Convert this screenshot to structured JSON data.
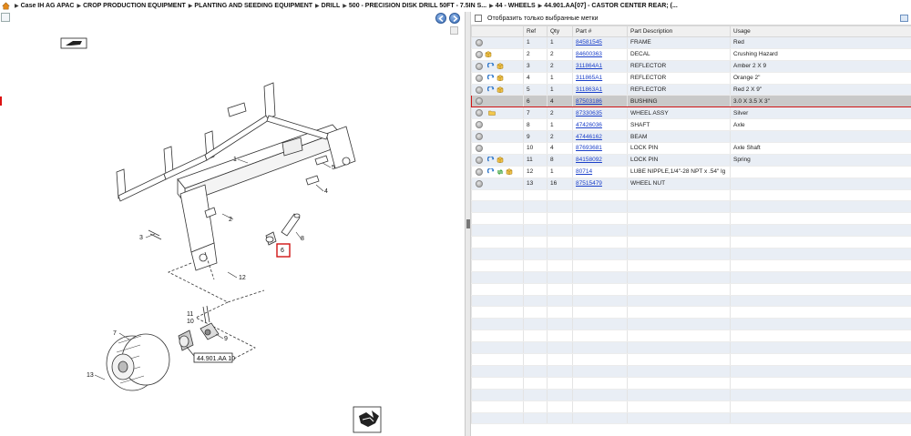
{
  "breadcrumb": [
    "Case IH AG APAC",
    "CROP PRODUCTION EQUIPMENT",
    "PLANTING AND SEEDING EQUIPMENT",
    "DRILL",
    "500 - PRECISION DISK DRILL 50FT - 7.5IN S...",
    "44 - WHEELS",
    "44.901.AA[07] - CASTOR CENTER REAR; (..."
  ],
  "filter": {
    "label": "Отобразить только выбранные метки"
  },
  "table": {
    "headers": [
      "",
      "Ref",
      "Qty",
      "Part #",
      "Part Description",
      "Usage"
    ],
    "rows": [
      {
        "ref": "1",
        "qty": "1",
        "part": "84581545",
        "desc": "FRAME",
        "usage": "Red",
        "icons": []
      },
      {
        "ref": "2",
        "qty": "2",
        "part": "84600363",
        "desc": "DECAL",
        "usage": "Crushing Hazard",
        "icons": [
          "box"
        ]
      },
      {
        "ref": "3",
        "qty": "2",
        "part": "311864A1",
        "desc": "REFLECTOR",
        "usage": "Amber 2 X 9",
        "icons": [
          "refresh",
          "box"
        ]
      },
      {
        "ref": "4",
        "qty": "1",
        "part": "311865A1",
        "desc": "REFLECTOR",
        "usage": "Orange 2\"",
        "icons": [
          "refresh",
          "box"
        ]
      },
      {
        "ref": "5",
        "qty": "1",
        "part": "311863A1",
        "desc": "REFLECTOR",
        "usage": "Red 2 X 9\"",
        "icons": [
          "refresh",
          "box"
        ]
      },
      {
        "ref": "6",
        "qty": "4",
        "part": "87503186",
        "desc": "BUSHING",
        "usage": "3.0 X 3.5 X 3\"",
        "icons": [],
        "selected": true
      },
      {
        "ref": "7",
        "qty": "2",
        "part": "87330635",
        "desc": "WHEEL ASSY",
        "usage": "Silver",
        "icons": [
          "folder"
        ]
      },
      {
        "ref": "8",
        "qty": "1",
        "part": "47426036",
        "desc": "SHAFT",
        "usage": "Axle",
        "icons": []
      },
      {
        "ref": "9",
        "qty": "2",
        "part": "47446162",
        "desc": "BEAM",
        "usage": "",
        "icons": []
      },
      {
        "ref": "10",
        "qty": "4",
        "part": "87693681",
        "desc": "LOCK PIN",
        "usage": "Axle Shaft",
        "icons": []
      },
      {
        "ref": "11",
        "qty": "8",
        "part": "84158092",
        "desc": "LOCK PIN",
        "usage": "Spring",
        "icons": [
          "refresh",
          "box"
        ]
      },
      {
        "ref": "12",
        "qty": "1",
        "part": "80714",
        "desc": "LUBE NIPPLE,1/4\"-28 NPT x .54\" lg",
        "usage": "",
        "icons": [
          "refresh",
          "arrows",
          "box"
        ]
      },
      {
        "ref": "13",
        "qty": "16",
        "part": "87515479",
        "desc": "WHEEL NUT",
        "usage": "",
        "icons": []
      }
    ]
  },
  "diagram": {
    "callouts": [
      "1",
      "2",
      "3",
      "4",
      "5",
      "6",
      "7",
      "8",
      "9",
      "10",
      "11",
      "12",
      "13"
    ],
    "reference_label": "44.901.AA 10"
  },
  "colors": {
    "link": "#1a3fc9",
    "selection_border": "#d01414",
    "alt_row": "#e9eef5"
  }
}
